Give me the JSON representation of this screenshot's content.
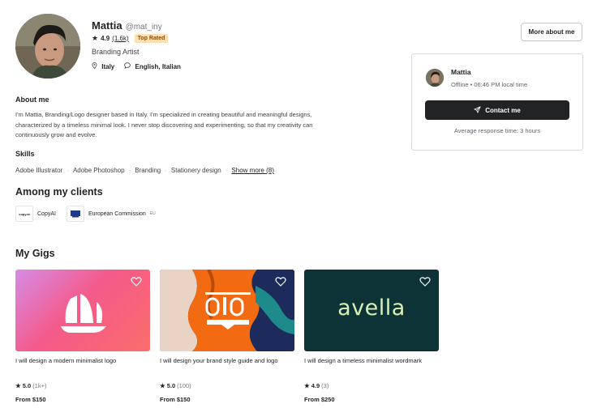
{
  "profile": {
    "name": "Mattia",
    "handle": "@mat_iny",
    "rating": "4.9",
    "rating_count": "(1.6k)",
    "badge": "Top Rated",
    "title": "Branding Artist",
    "location": "Italy",
    "languages": "English, Italian",
    "more_button": "More about me"
  },
  "contact_card": {
    "name": "Mattia",
    "status": "Offline • 06:46 PM local time",
    "button": "Contact me",
    "response": "Average response time: 3 hours"
  },
  "about": {
    "heading": "About me",
    "text": "I'm Mattia, Branding/Logo designer based in Italy. I'm specialized in creating beautiful and meaningful designs, characterized by a timeless minimal look. I never stop discovering and experimenting, so that my creativity can continuously grow and evolve."
  },
  "skills": {
    "heading": "Skills",
    "items": [
      "Adobe Illustrator",
      "Adobe Photoshop",
      "Branding",
      "Stationery design"
    ],
    "show_more": "Show more (8)"
  },
  "clients": {
    "heading": "Among my clients",
    "items": [
      {
        "logo_text": "copy.ai",
        "name": "CopyAI",
        "suffix": ""
      },
      {
        "logo_text": "",
        "name": "European Commission",
        "suffix": "EU"
      }
    ]
  },
  "gigs": {
    "heading": "My Gigs",
    "items": [
      {
        "title": "I will design a modern minimalist logo",
        "rating": "5.0",
        "count": "(1k+)",
        "price": "From $150",
        "brand": ""
      },
      {
        "title": "I will design your brand style guide and logo",
        "rating": "5.0",
        "count": "(100)",
        "price": "From $150",
        "brand": ""
      },
      {
        "title": "I will design a timeless minimalist wordmark",
        "rating": "4.9",
        "count": "(3)",
        "price": "From $250",
        "brand": "avella"
      }
    ]
  },
  "colors": {
    "accent_dark": "#222325",
    "badge_bg": "#ffe0b3",
    "avella_bg": "#0d3337",
    "avella_text": "#d9f0b5"
  }
}
